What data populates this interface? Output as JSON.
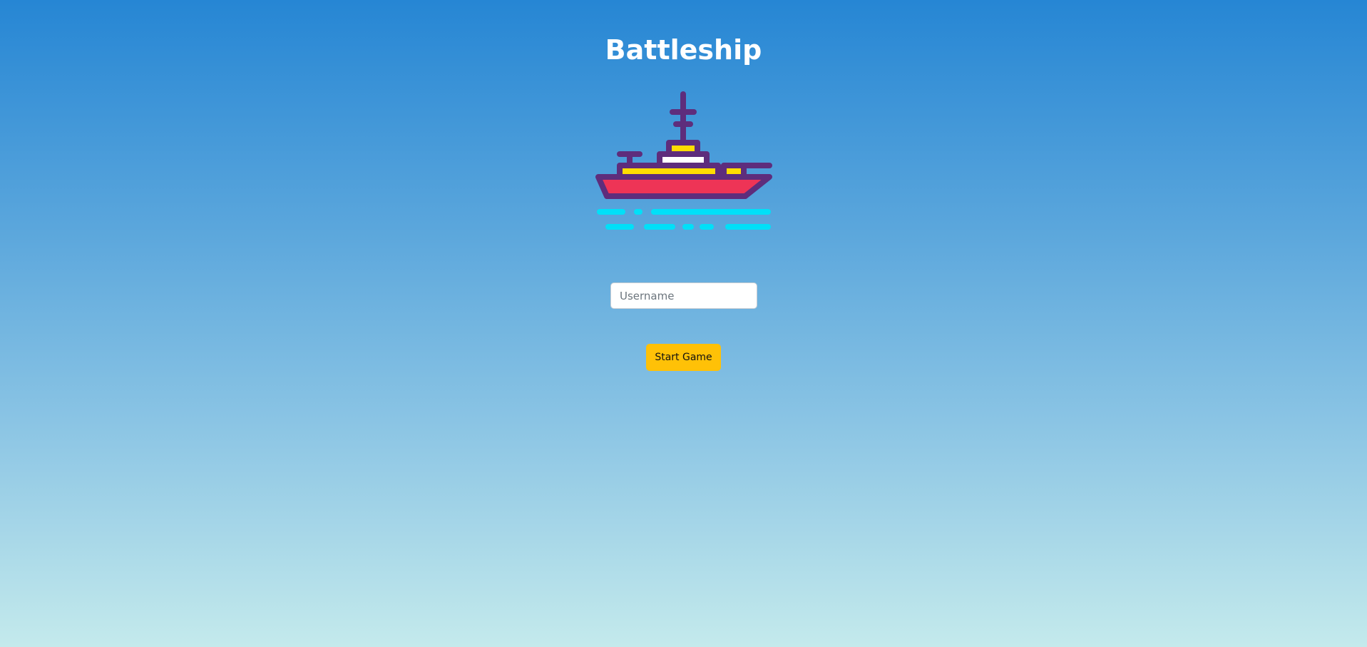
{
  "page": {
    "title": "Battleship"
  },
  "illustration": {
    "icon": "battleship-icon",
    "colors": {
      "outline": "#5e2d7c",
      "hull": "#ee3456",
      "windows": "#ffdd00",
      "bridge_window": "#ffffff",
      "water": "#00e0f8"
    }
  },
  "form": {
    "username_placeholder": "Username",
    "username_value": "",
    "start_label": "Start Game"
  },
  "colors": {
    "background_top": "#2686d4",
    "background_bottom": "#c4eaec",
    "button": "#ffc107"
  }
}
